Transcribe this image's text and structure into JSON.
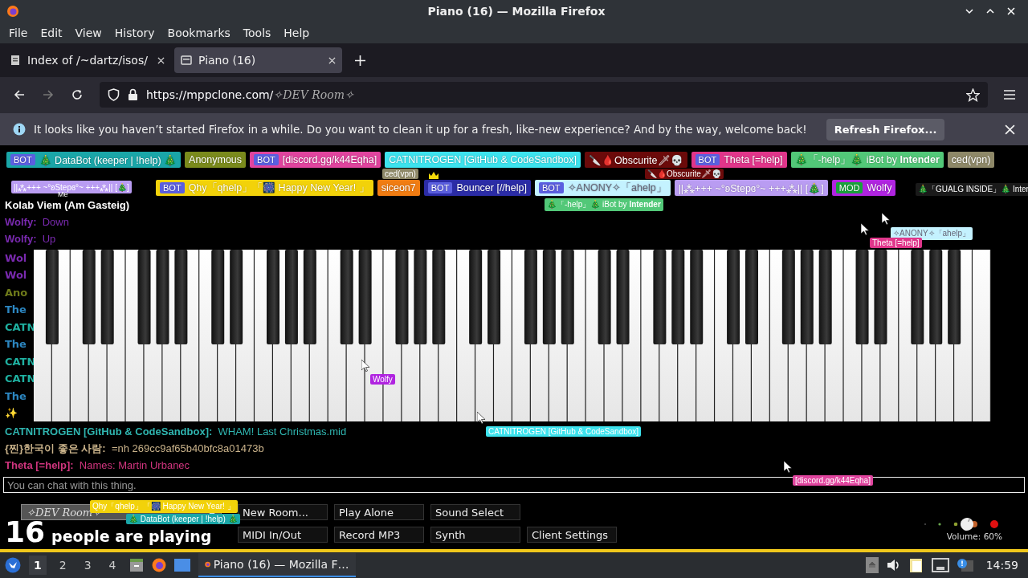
{
  "window": {
    "title": "Piano (16) — Mozilla Firefox"
  },
  "menu": [
    "File",
    "Edit",
    "View",
    "History",
    "Bookmarks",
    "Tools",
    "Help"
  ],
  "tabs": [
    {
      "label": "Index of /~dartz/isos/",
      "selected": false
    },
    {
      "label": "Piano (16)",
      "selected": true
    }
  ],
  "address": {
    "host": "https://mppclone.com/",
    "path": "✧DEV Room✧"
  },
  "notification": {
    "message": "It looks like you haven’t started Firefox in a while. Do you want to clean it up for a fresh, like-new experience? And by the way, welcome back!",
    "button": "Refresh Firefox..."
  },
  "users": [
    {
      "badge": "BOT",
      "name": "🎄 DataBot (keeper | !help) 🎄",
      "color": "#1aa6a8"
    },
    {
      "name": "Anonymous",
      "color": "#7a8a1c"
    },
    {
      "badge": "BOT",
      "name": "[discord.gg/k44Eqha]",
      "color": "#e0449e"
    },
    {
      "name": "CATNITROGEN [GitHub & CodeSandbox]",
      "color": "#3de3ee"
    },
    {
      "name": "🔪🩸Obscurite🗡💀",
      "color": "#6b0a0a"
    },
    {
      "badge": "BOT",
      "name": "Theta [=help]",
      "color": "#e0358a"
    },
    {
      "name": "🎄「-help」🎄 iBot by **Intender**",
      "color": "#52c878"
    },
    {
      "name": "ced(vpn)",
      "color": "#8e8868"
    },
    {
      "badge": "BOT",
      "name": "Qhy「qhelp」「🎆 Happy New Year! 」",
      "color": "#f2d20a"
    },
    {
      "name": "siceon7",
      "color": "#f07c12"
    },
    {
      "badge": "BOT",
      "name": "Bouncer [//help]",
      "color": "#2b2ca6",
      "owner": true
    },
    {
      "badge": "BOT",
      "name": "✧ANONY✧「ahelp」",
      "color": "#c4f2ff"
    },
    {
      "name": "||⁂+++ ~°ʚStepɞ°~ +++⁂|| [🎄]",
      "color": "#b99cf2"
    },
    {
      "badge": "MOD",
      "name": "Wolfy",
      "color": "#b024e0"
    }
  ],
  "cursors": [
    {
      "label": "ced(vpn)",
      "color": "#8e8868"
    },
    {
      "label": "🔪🩸Obscurite🗡💀",
      "color": "#6b0a0a"
    },
    {
      "label": "||⁂+++ ~°ʚStepɞ°~ +++⁂|| [🎄]",
      "color": "#b99cf2"
    },
    {
      "label": "🎄「GUALG INSIDE」🎄 Inter",
      "color": "#1a1a1a"
    },
    {
      "label": "Me"
    },
    {
      "label": "🎄「-help」🎄 iBot by **Intender**",
      "color": "#52c878"
    },
    {
      "label": "✧ANONY✧「ahelp」",
      "color": "#c4f2ff"
    },
    {
      "label": "Theta [=help]",
      "color": "#e0358a"
    },
    {
      "label": "Wolfy",
      "color": "#b024e0"
    },
    {
      "label": "CATNITROGEN [GitHub & CodeSandbox]",
      "color": "#3de3ee"
    },
    {
      "label": "[discord.gg/k44Eqha]",
      "color": "#e0449e"
    },
    {
      "label": "Qhy「qhelp」「🎆 Happy New Year! 」",
      "color": "#f2d20a"
    },
    {
      "label": "🎄 DataBot (keeper | !help) 🎄",
      "color": "#1aa6a8"
    }
  ],
  "chat_above": [
    {
      "name": "Kolab Viem (Am Gasteig)",
      "color": "#ffffff"
    },
    {
      "name": "Wolfy:",
      "message": "Down",
      "color": "#7a2ab0"
    },
    {
      "name": "Wolfy:",
      "message": "Up",
      "color": "#7a2ab0"
    }
  ],
  "chat_behind": [
    {
      "name": "Wol",
      "color": "#7a2ab0"
    },
    {
      "name": "Wol",
      "color": "#7a2ab0"
    },
    {
      "name": "Ano",
      "color": "#6e7a1a"
    },
    {
      "name": "The",
      "color": "#2c86c0"
    },
    {
      "name": "CATN",
      "color": "#1fb0a0"
    },
    {
      "name": "The",
      "color": "#2c86c0"
    },
    {
      "name": "CATN",
      "color": "#1fb0a0"
    },
    {
      "name": "CATN",
      "color": "#1fb0a0"
    },
    {
      "name": "The",
      "color": "#2c86c0"
    },
    {
      "name": "✨"
    }
  ],
  "chat_below": [
    {
      "name": "CATNITROGEN [GitHub & CodeSandbox]:",
      "message": "WHAM! Last Christmas.mid",
      "color": "#2fb5b0"
    },
    {
      "name": "{찐}한국이 좋은 사람:",
      "message": "=nh 269cc9af65b40bfc8a01473b",
      "color": "#c9b28a"
    },
    {
      "name": "Theta [=help]:",
      "message": "Names: Martin Urbanec",
      "color": "#d0357e"
    }
  ],
  "chat_input": {
    "placeholder": "You can chat with this thing."
  },
  "room": {
    "name": "✧DEV Room✧"
  },
  "player_count": "16",
  "player_text": "people are playing",
  "buttons": [
    [
      "New Room...",
      "Play Alone",
      "Sound Select"
    ],
    [
      "MIDI In/Out",
      "Record MP3",
      "Synth",
      "Client Settings"
    ]
  ],
  "volume": {
    "level": 0.6,
    "label": "Volume: 60%"
  },
  "taskbar": {
    "workspaces": [
      {
        "label": "1",
        "selected": true
      },
      {
        "label": "2",
        "selected": false
      },
      {
        "label": "3",
        "selected": false
      },
      {
        "label": "4",
        "selected": false
      }
    ],
    "task": "Piano (16) — Mozilla F…",
    "clock": "14:59"
  }
}
